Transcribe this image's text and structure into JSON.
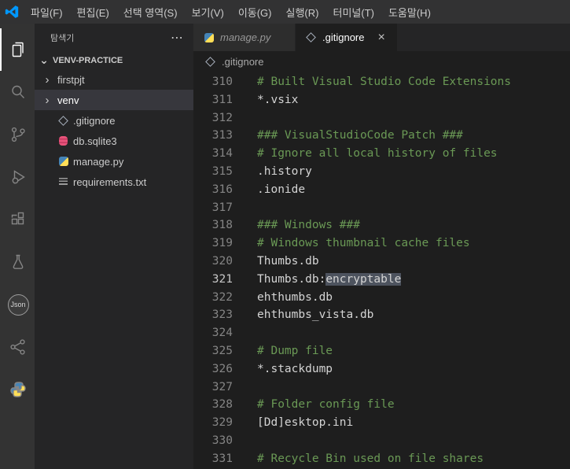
{
  "menu_bar": {
    "items": [
      "파일(F)",
      "편집(E)",
      "선택 영역(S)",
      "보기(V)",
      "이동(G)",
      "실행(R)",
      "터미널(T)",
      "도움말(H)"
    ]
  },
  "activity_bar": {
    "json_badge_label": "Json"
  },
  "sidebar": {
    "title": "탐색기",
    "more_actions": "⋯",
    "root": "VENV-PRACTICE",
    "items": [
      {
        "label": "firstpjt",
        "type": "folder"
      },
      {
        "label": "venv",
        "type": "folder",
        "selected": true
      },
      {
        "label": ".gitignore",
        "type": "file",
        "icon": "git"
      },
      {
        "label": "db.sqlite3",
        "type": "file",
        "icon": "db"
      },
      {
        "label": "manage.py",
        "type": "file",
        "icon": "py"
      },
      {
        "label": "requirements.txt",
        "type": "file",
        "icon": "txt"
      }
    ]
  },
  "tabs": [
    {
      "label": "manage.py",
      "icon": "py",
      "state": "preview"
    },
    {
      "label": ".gitignore",
      "icon": "git",
      "state": "active"
    }
  ],
  "breadcrumb": {
    "file": ".gitignore"
  },
  "editor": {
    "language": "gitignore",
    "lines": [
      {
        "n": 310,
        "parts": [
          {
            "t": "# Built Visual Studio Code Extensions",
            "c": "comment"
          }
        ]
      },
      {
        "n": 311,
        "parts": [
          {
            "t": "*.vsix",
            "c": "plain"
          }
        ]
      },
      {
        "n": 312,
        "parts": []
      },
      {
        "n": 313,
        "parts": [
          {
            "t": "### VisualStudioCode Patch ###",
            "c": "comment"
          }
        ]
      },
      {
        "n": 314,
        "parts": [
          {
            "t": "# Ignore all local history of files",
            "c": "comment"
          }
        ]
      },
      {
        "n": 315,
        "parts": [
          {
            "t": ".history",
            "c": "plain"
          }
        ]
      },
      {
        "n": 316,
        "parts": [
          {
            "t": ".ionide",
            "c": "plain"
          }
        ]
      },
      {
        "n": 317,
        "parts": []
      },
      {
        "n": 318,
        "parts": [
          {
            "t": "### Windows ###",
            "c": "comment"
          }
        ]
      },
      {
        "n": 319,
        "parts": [
          {
            "t": "# Windows thumbnail cache files",
            "c": "comment"
          }
        ]
      },
      {
        "n": 320,
        "parts": [
          {
            "t": "Thumbs.db",
            "c": "plain"
          }
        ]
      },
      {
        "n": 321,
        "active": true,
        "parts": [
          {
            "t": "Thumbs.db:",
            "c": "plain"
          },
          {
            "t": "encryptable",
            "c": "plain",
            "hl": true
          }
        ]
      },
      {
        "n": 322,
        "parts": [
          {
            "t": "ehthumbs.db",
            "c": "plain"
          }
        ]
      },
      {
        "n": 323,
        "parts": [
          {
            "t": "ehthumbs_vista.db",
            "c": "plain"
          }
        ]
      },
      {
        "n": 324,
        "parts": []
      },
      {
        "n": 325,
        "parts": [
          {
            "t": "# Dump file",
            "c": "comment"
          }
        ]
      },
      {
        "n": 326,
        "parts": [
          {
            "t": "*.stackdump",
            "c": "plain"
          }
        ]
      },
      {
        "n": 327,
        "parts": []
      },
      {
        "n": 328,
        "parts": [
          {
            "t": "# Folder config file",
            "c": "comment"
          }
        ]
      },
      {
        "n": 329,
        "parts": [
          {
            "t": "[Dd]esktop.ini",
            "c": "plain"
          }
        ]
      },
      {
        "n": 330,
        "parts": []
      },
      {
        "n": 331,
        "parts": [
          {
            "t": "# Recycle Bin used on file shares",
            "c": "comment"
          }
        ]
      }
    ]
  },
  "colors": {
    "accent_blue": "#0098ff",
    "comment_green": "#6a9955",
    "plain_text": "#d4d4d4",
    "word_highlight": "#4d535e",
    "db_icon_pink": "#e8537a",
    "python_blue": "#4584b6",
    "python_yellow": "#ffde57",
    "selected_row": "#37373d"
  }
}
